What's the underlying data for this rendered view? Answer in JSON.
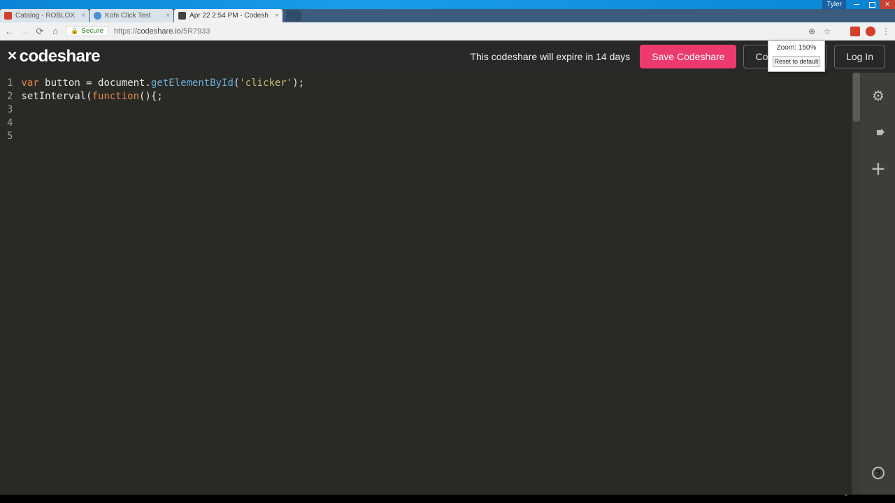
{
  "window": {
    "user_label": "Tyler"
  },
  "tabs": [
    {
      "title": "Catalog - ROBLOX",
      "active": false
    },
    {
      "title": "Kohi Click Test",
      "active": false
    },
    {
      "title": "Apr 22 2:54 PM - Codesh",
      "active": true
    }
  ],
  "address_bar": {
    "secure_label": "Secure",
    "url_scheme": "https://",
    "url_host": "codeshare.io",
    "url_path": "/5R7933"
  },
  "zoom_popup": {
    "label": "Zoom: 150%",
    "reset_label": "Reset to default"
  },
  "header": {
    "logo_text": "codeshare",
    "expire_text": "This codeshare will expire in 14 days",
    "save_label": "Save Codeshare",
    "free_label": "Codeshare Fr",
    "login_label": "Log In"
  },
  "editor": {
    "line_numbers": [
      "1",
      "2",
      "3",
      "4",
      "5"
    ],
    "lines": [
      [
        {
          "t": "kw",
          "v": "var"
        },
        {
          "t": "pnc",
          "v": " "
        },
        {
          "t": "id",
          "v": "button"
        },
        {
          "t": "pnc",
          "v": " = "
        },
        {
          "t": "id",
          "v": "document"
        },
        {
          "t": "pnc",
          "v": "."
        },
        {
          "t": "fn",
          "v": "getElementById"
        },
        {
          "t": "pnc",
          "v": "("
        },
        {
          "t": "str",
          "v": "'clicker'"
        },
        {
          "t": "pnc",
          "v": ");"
        }
      ],
      [
        {
          "t": "id",
          "v": "setInterval"
        },
        {
          "t": "pnc",
          "v": "("
        },
        {
          "t": "fn2",
          "v": "function"
        },
        {
          "t": "pnc",
          "v": "(){;"
        }
      ],
      [],
      [],
      []
    ]
  },
  "side_rail": {
    "settings": "settings",
    "video": "video",
    "add": "add",
    "help": "help"
  }
}
